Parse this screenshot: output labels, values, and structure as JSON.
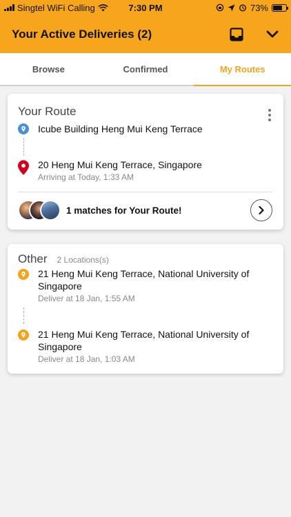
{
  "status_bar": {
    "carrier": "Singtel WiFi Calling",
    "time": "7:30 PM",
    "battery": "73%",
    "battery_level": 0.73
  },
  "header": {
    "title": "Your Active Deliveries (2)"
  },
  "tabs": [
    {
      "label": "Browse",
      "active": false
    },
    {
      "label": "Confirmed",
      "active": false
    },
    {
      "label": "My Routes",
      "active": true
    }
  ],
  "your_route": {
    "title": "Your Route",
    "origin": {
      "address": "Icube Building Heng Mui Keng Terrace",
      "icon": "origin-pin-icon",
      "color": "#4a90d9"
    },
    "destination": {
      "address": "20 Heng Mui Keng Terrace, Singapore",
      "meta": "Arriving at Today, 1:33 AM",
      "icon": "map-pin-icon",
      "color": "#d0021b"
    },
    "matches_text": "1 matches for Your Route!"
  },
  "other": {
    "title": "Other",
    "count": "2 Locations(s)",
    "stops": [
      {
        "address": "21 Heng Mui Keng Terrace, National University of Singapore",
        "meta": "Deliver at 18 Jan, 1:55 AM",
        "color": "#f2a51c"
      },
      {
        "address": "21 Heng Mui Keng Terrace, National University of Singapore",
        "meta": "Deliver at 18 Jan, 1:03 AM",
        "color": "#f2a51c"
      }
    ]
  },
  "colors": {
    "accent": "#f6a51c",
    "tab_active": "#f2a51c"
  }
}
